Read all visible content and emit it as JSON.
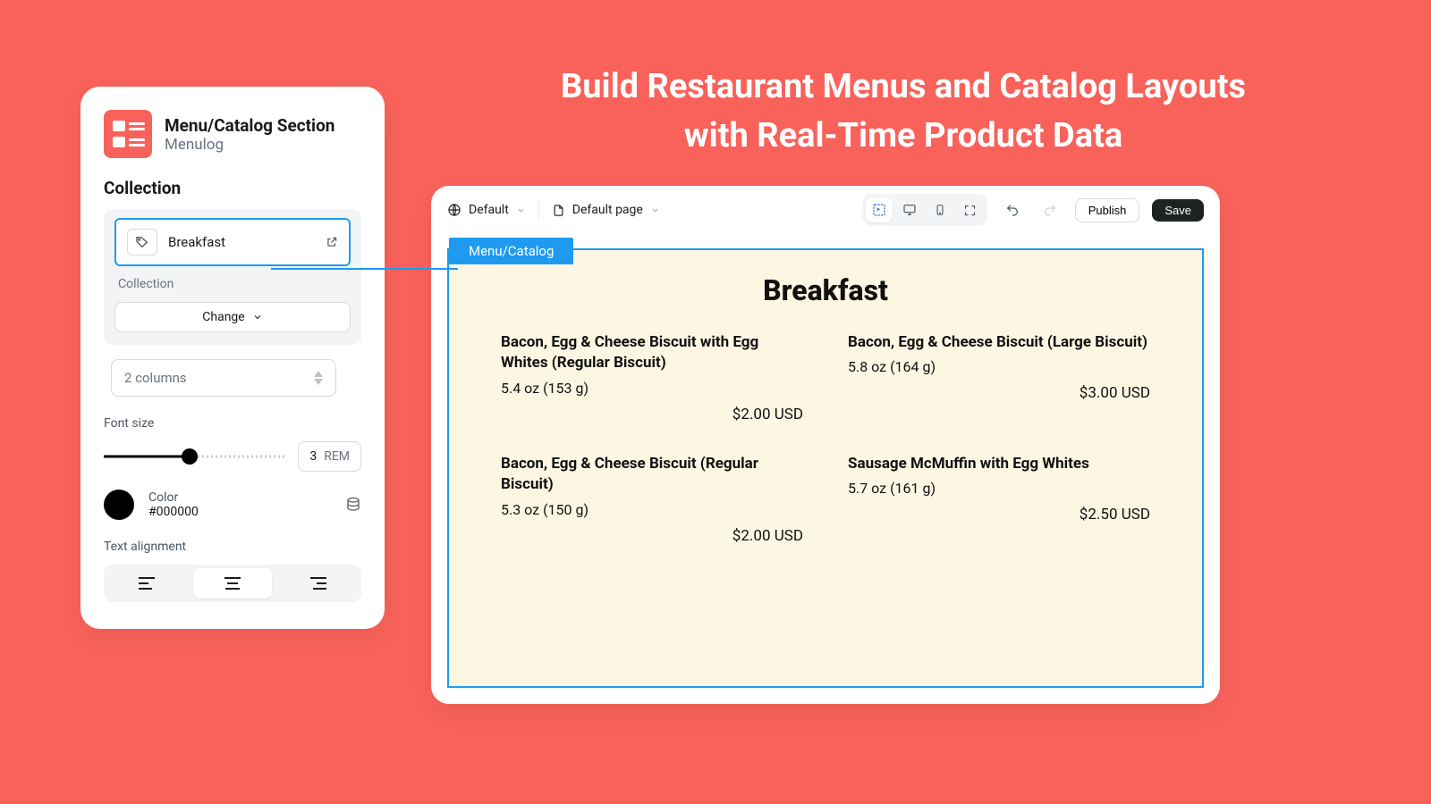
{
  "hero": {
    "line1": "Build Restaurant Menus and Catalog Layouts",
    "line2": "with Real-Time Product Data"
  },
  "panel": {
    "title": "Menu/Catalog Section",
    "subtitle": "Menulog",
    "collection": {
      "section_label": "Collection",
      "chip_value": "Breakfast",
      "field_sublabel": "Collection",
      "change_label": "Change"
    },
    "columns": {
      "value": "2 columns"
    },
    "font_size": {
      "label": "Font size",
      "value": "3",
      "unit": "REM"
    },
    "color": {
      "label": "Color",
      "hex": "#000000"
    },
    "alignment": {
      "label": "Text alignment",
      "active": "center"
    }
  },
  "editor": {
    "theme_label": "Default",
    "page_label": "Default page",
    "publish": "Publish",
    "save": "Save",
    "selection_tab": "Menu/Catalog",
    "menu_title": "Breakfast",
    "items": [
      {
        "name": "Bacon, Egg & Cheese Biscuit with Egg Whites (Regular Biscuit)",
        "meta": "5.4 oz (153 g)",
        "price": "$2.00 USD"
      },
      {
        "name": "Bacon, Egg & Cheese Biscuit (Large Biscuit)",
        "meta": "5.8 oz (164 g)",
        "price": "$3.00 USD"
      },
      {
        "name": "Bacon, Egg & Cheese Biscuit (Regular Biscuit)",
        "meta": "5.3 oz (150 g)",
        "price": "$2.00 USD"
      },
      {
        "name": "Sausage McMuffin with Egg Whites",
        "meta": "5.7 oz (161 g)",
        "price": "$2.50 USD"
      }
    ]
  }
}
